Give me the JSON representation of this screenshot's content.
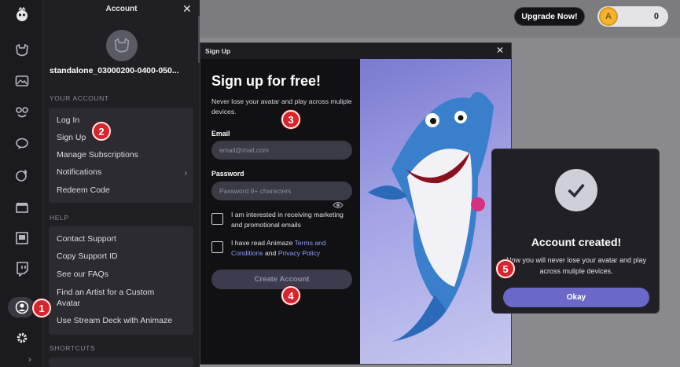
{
  "app": {
    "upgrade_label": "Upgrade Now!",
    "coin_symbol": "A",
    "coin_count": "0"
  },
  "rail": {
    "icons": [
      "logo-icon",
      "avatar-icon",
      "scene-icon",
      "props-icon",
      "chat-icon",
      "emote-icon",
      "clapper-icon",
      "screen-icon",
      "twitch-icon",
      "account-icon",
      "gear-icon"
    ],
    "expand_glyph": "›"
  },
  "account": {
    "title": "Account",
    "close_glyph": "✕",
    "username": "standalone_03000200-0400-050...",
    "your_account_label": "YOUR ACCOUNT",
    "items": [
      {
        "label": "Log In"
      },
      {
        "label": "Sign Up"
      },
      {
        "label": "Manage Subscriptions"
      },
      {
        "label": "Notifications",
        "chevron": "›"
      },
      {
        "label": "Redeem Code"
      }
    ],
    "help_label": "HELP",
    "help_items": [
      {
        "label": "Contact Support"
      },
      {
        "label": "Copy Support ID"
      },
      {
        "label": "See our FAQs"
      },
      {
        "label": "Find an Artist for a Custom Avatar"
      },
      {
        "label": "Use Stream Deck with Animaze"
      }
    ],
    "shortcuts_label": "SHORTCUTS"
  },
  "signup": {
    "window_title": "Sign Up",
    "close_glyph": "✕",
    "heading": "Sign up for free!",
    "subtitle": "Never lose your avatar and play across muliple devices.",
    "email_label": "Email",
    "email_placeholder": "email@mail.com",
    "password_label": "Password",
    "password_placeholder": "Password 8+ characters",
    "marketing_checkbox": "I am interested in receiving marketing and promotional emails",
    "terms_prefix": "I have read Animaze ",
    "terms_link": "Terms and Conditions",
    "terms_and": " and ",
    "privacy_link": "Privacy Policy",
    "create_button": "Create Account"
  },
  "toast": {
    "title": "Account created!",
    "message": "Now you will never lose your avatar and play across muliple devices.",
    "okay_button": "Okay"
  },
  "steps": [
    "1",
    "2",
    "3",
    "4",
    "5"
  ],
  "colors": {
    "accent": "#6a68c8",
    "step_marker": "#d8242b",
    "link": "#8f9cf6"
  }
}
